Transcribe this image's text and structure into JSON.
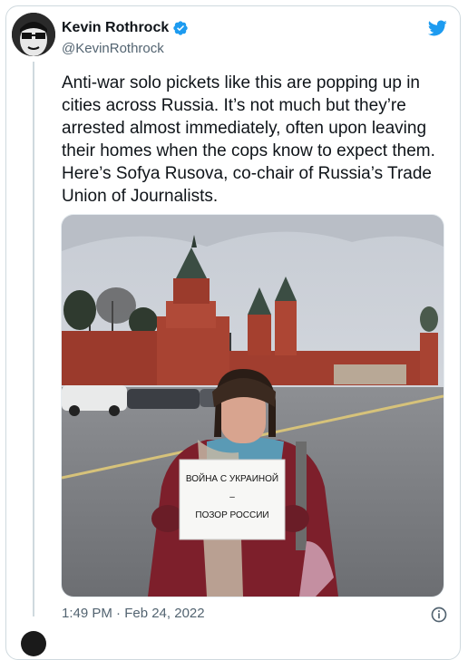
{
  "author": {
    "display_name": "Kevin Rothrock",
    "handle": "@KevinRothrock",
    "verified": true,
    "avatar_icon": "avatar-glasses-illustration"
  },
  "tweet": {
    "text": "Anti-war solo pickets like this are popping up in cities across Russia. It’s not much but they’re arrested almost immediately, often upon leaving their homes when the cops know to expect them. Here’s Sofya Rusova, co-chair of Russia’s Trade Union of Journalists.",
    "timestamp": "1:49 PM · Feb 24, 2022"
  },
  "photo": {
    "sign_line1": "ВОЙНА С УКРАИНОЙ",
    "sign_line2": "–",
    "sign_line3": "ПОЗОР РОССИИ"
  },
  "icons": {
    "brand": "twitter-bird-icon",
    "verified": "verified-badge-icon",
    "info": "info-icon"
  },
  "colors": {
    "brand": "#1d9bf0",
    "text": "#0f1419",
    "muted": "#536471",
    "border": "#cfd9de"
  }
}
